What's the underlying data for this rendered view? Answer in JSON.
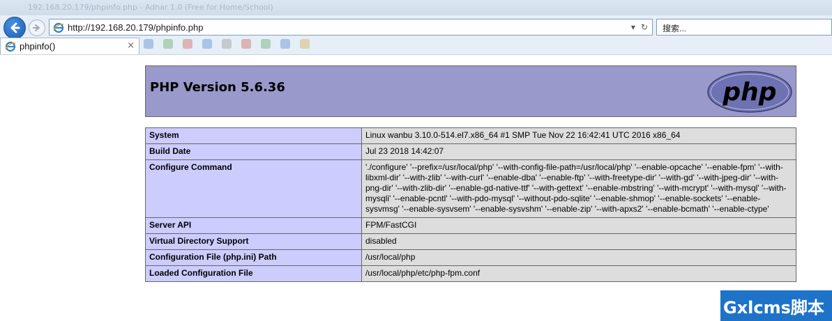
{
  "browser": {
    "window_title": "192.168.20.179/phpinfo.php - Adhar 1.0 (Free for Home/School)",
    "url": "http://192.168.20.179/phpinfo.php",
    "search_placeholder": "搜索...",
    "tab_title": "phpinfo()",
    "tab_close": "×",
    "addr_dropdown": "▾",
    "addr_refresh": "↻",
    "colors": {
      "chrome": "#e6eef7",
      "back_button": "#1a5db8"
    }
  },
  "phpinfo": {
    "version_title": "PHP Version 5.6.36",
    "logo_text": "php",
    "colors": {
      "header": "#9999cc",
      "key_cell": "#ccccff",
      "value_cell": "#dddddd"
    },
    "rows": [
      {
        "key": "System",
        "value": "Linux wanbu 3.10.0-514.el7.x86_64 #1 SMP Tue Nov 22 16:42:41 UTC 2016 x86_64"
      },
      {
        "key": "Build Date",
        "value": "Jul 23 2018 14:42:07"
      },
      {
        "key": "Configure Command",
        "value": "'./configure' '--prefix=/usr/local/php' '--with-config-file-path=/usr/local/php' '--enable-opcache' '--enable-fpm' '--with-libxml-dir' '--with-zlib' '--with-curl' '--enable-dba' '--enable-ftp' '--with-freetype-dir' '--with-gd' '--with-jpeg-dir' '--with-png-dir' '--with-zlib-dir' '--enable-gd-native-ttf' '--with-gettext' '--enable-mbstring' '--with-mcrypt' '--with-mysql' '--with-mysqli' '--enable-pcntl' '--with-pdo-mysql' '--without-pdo-sqlite' '--enable-shmop' '--enable-sockets' '--enable-sysvmsg' '--enable-sysvsem' '--enable-sysvshm' '--enable-zip' '--with-apxs2' '--enable-bcmath' '--enable-ctype'"
      },
      {
        "key": "Server API",
        "value": "FPM/FastCGI"
      },
      {
        "key": "Virtual Directory Support",
        "value": "disabled"
      },
      {
        "key": "Configuration File (php.ini) Path",
        "value": "/usr/local/php"
      },
      {
        "key": "Loaded Configuration File",
        "value": "/usr/local/php/etc/php-fpm.conf"
      }
    ]
  },
  "watermark": {
    "text": "Gxlcms脚本"
  }
}
